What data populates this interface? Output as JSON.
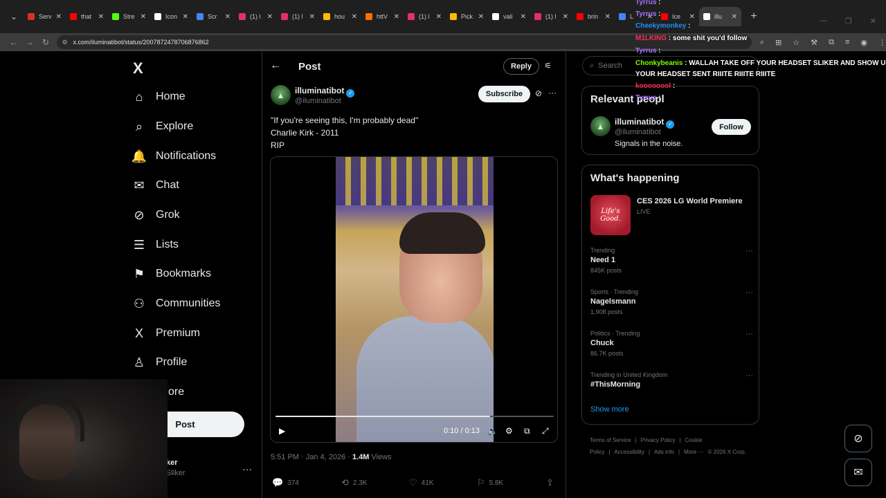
{
  "browser": {
    "tabs": [
      {
        "label": "Serv",
        "color": "#d93025"
      },
      {
        "label": "that",
        "color": "#ff0000"
      },
      {
        "label": "Stre",
        "color": "#53fc18"
      },
      {
        "label": "Icon",
        "color": "#ffffff"
      },
      {
        "label": "Scr",
        "color": "#4285f4"
      },
      {
        "label": "(1) l",
        "color": "#e1306c"
      },
      {
        "label": "(1) l",
        "color": "#e1306c"
      },
      {
        "label": "hou",
        "color": "#fbbc04"
      },
      {
        "label": "httV",
        "color": "#ff6f00"
      },
      {
        "label": "(1) l",
        "color": "#e1306c"
      },
      {
        "label": "Pick",
        "color": "#fbbc04"
      },
      {
        "label": "vali",
        "color": "#ffffff"
      },
      {
        "label": "(1) l",
        "color": "#e1306c"
      },
      {
        "label": "brin",
        "color": "#ff0000"
      },
      {
        "label": "L",
        "color": "#4285f4"
      },
      {
        "label": "Ice",
        "color": "#ff0000"
      },
      {
        "label": "illu",
        "color": "#ffffff"
      }
    ],
    "url": "x.com/iluminatibot/status/2007872478706876862"
  },
  "nav": {
    "logo": "X",
    "items": [
      {
        "label": "Home",
        "icon": "⌂"
      },
      {
        "label": "Explore",
        "icon": "⌕"
      },
      {
        "label": "Notifications",
        "icon": "🔔"
      },
      {
        "label": "Chat",
        "icon": "✉"
      },
      {
        "label": "Grok",
        "icon": "⊘"
      },
      {
        "label": "Lists",
        "icon": "☰"
      },
      {
        "label": "Bookmarks",
        "icon": "⚑"
      },
      {
        "label": "Communities",
        "icon": "⚇"
      },
      {
        "label": "Premium",
        "icon": "X"
      },
      {
        "label": "Profile",
        "icon": "♙"
      },
      {
        "label": "ore",
        "icon": ""
      }
    ],
    "post_label": "Post",
    "account_name": "ker",
    "account_handle": "Sliker"
  },
  "post": {
    "header_title": "Post",
    "reply_label": "Reply",
    "author_name": "illuminatibot",
    "author_handle": "@iluminatibot",
    "subscribe_label": "Subscribe",
    "text_lines": [
      "\"If you're seeing this, I'm probably dead\"",
      "Charlie Kirk - 2011",
      "RIP"
    ],
    "video_time": "0:10 / 0:13",
    "video_progress": 0.77,
    "timestamp": "5:51 PM · Jan 4, 2026 · ",
    "views": "1.4M",
    "views_label": " Views",
    "replies": "374",
    "reposts": "2.3K",
    "likes": "41K",
    "bookmarks": "5.8K"
  },
  "right": {
    "search_placeholder": "Search",
    "relevant_title": "Relevant peopl",
    "rp_name": "illuminatibot",
    "rp_handle": "@iluminatibot",
    "rp_bio": "Signals in the noise.",
    "follow_label": "Follow",
    "happening_title": "What's happening",
    "event_img_text": "Life's Good.",
    "event_title": "CES 2026 LG World Premiere",
    "event_live": "LIVE",
    "trends": [
      {
        "cat": "Trending",
        "name": "Need 1",
        "count": "845K posts"
      },
      {
        "cat": "Sports · Trending",
        "name": "Nagelsmann",
        "count": "1,908 posts"
      },
      {
        "cat": "Politics · Trending",
        "name": "Chuck",
        "count": "86.7K posts"
      },
      {
        "cat": "Trending in United Kingdom",
        "name": "#ThisMorning",
        "count": ""
      }
    ],
    "show_more": "Show more",
    "footer": [
      "Terms of Service",
      "|",
      "Privacy Policy",
      "|",
      "Cookie Policy",
      "|",
      "Accessibility",
      "|",
      "Ads info",
      "|",
      "More ···",
      "© 2026 X Corp."
    ]
  },
  "chat": [
    {
      "user": "Tyrrus",
      "msg": ":",
      "color": "#a970ff"
    },
    {
      "user": "Tyrrus",
      "msg": ":",
      "color": "#a970ff"
    },
    {
      "user": "Cheekymonkey",
      "msg": ":",
      "color": "#1e90ff"
    },
    {
      "user": "M1LKING",
      "msg": ": some shit you'd follow",
      "color": "#ff2d55"
    },
    {
      "user": "Tyrrus",
      "msg": ":",
      "color": "#a970ff"
    },
    {
      "user": "Chonkybeanis",
      "msg": ": WALLAH TAKE OFF YOUR HEADSET SLIKER AND SHOW US",
      "color": "#7fff00"
    },
    {
      "user": "",
      "msg": "YOUR HEADSET SENT RIIITE RIIITE RIIITE",
      "color": "#ffffff"
    },
    {
      "user": "koooooool",
      "msg": ":",
      "color": "#ff2d55"
    },
    {
      "user": "Tyrrus",
      "msg": ":",
      "color": "#a970ff"
    }
  ]
}
